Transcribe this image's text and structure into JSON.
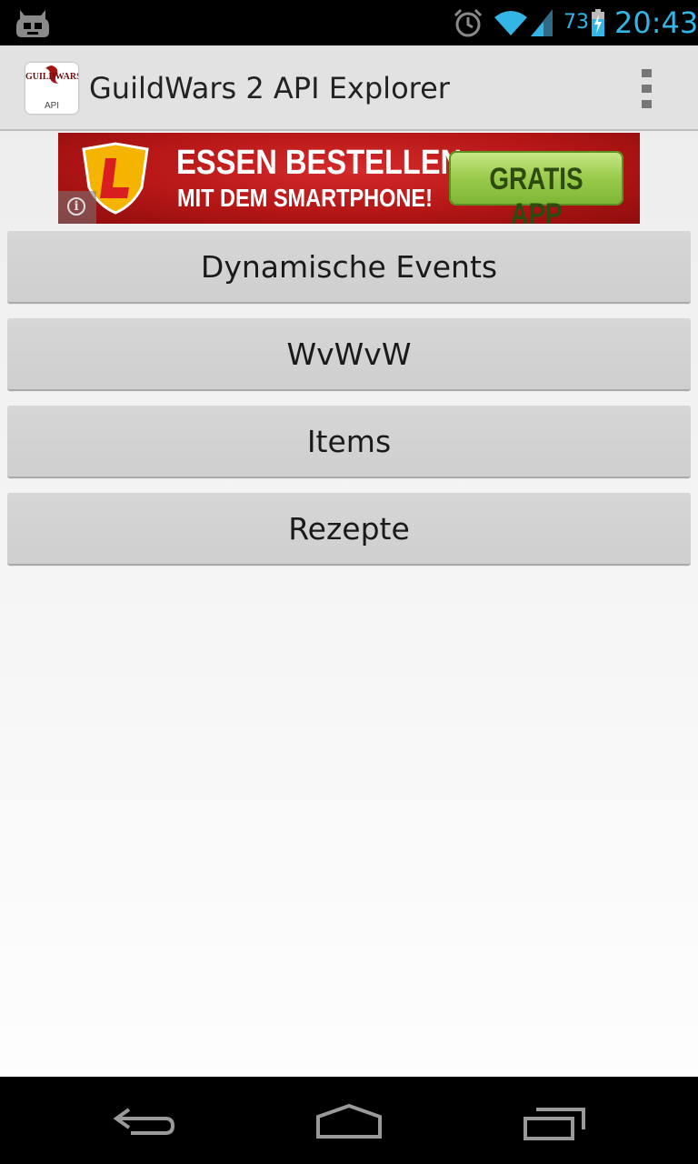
{
  "status_bar": {
    "battery_percent": "73",
    "time": "20:43",
    "icons": [
      "cyanogenmod-icon",
      "alarm-icon",
      "wifi-icon",
      "cell-signal-icon",
      "battery-charging-icon"
    ],
    "accent_color": "#33b5e5"
  },
  "action_bar": {
    "title": "GuildWars 2 API Explorer",
    "app_icon": {
      "logo_text": "GUILDWARS",
      "badge_text": "API"
    },
    "overflow_icon": "overflow-menu-icon"
  },
  "ad": {
    "line1": "ESSEN BESTELLEN",
    "line2": "MIT DEM SMARTPHONE!",
    "cta": "GRATIS APP",
    "info_icon": "info-icon"
  },
  "menu": {
    "items": [
      {
        "label": "Dynamische Events"
      },
      {
        "label": "WvWvW"
      },
      {
        "label": "Items"
      },
      {
        "label": "Rezepte"
      }
    ]
  },
  "nav_bar": {
    "icons": [
      "back-icon",
      "home-icon",
      "recent-apps-icon"
    ]
  }
}
